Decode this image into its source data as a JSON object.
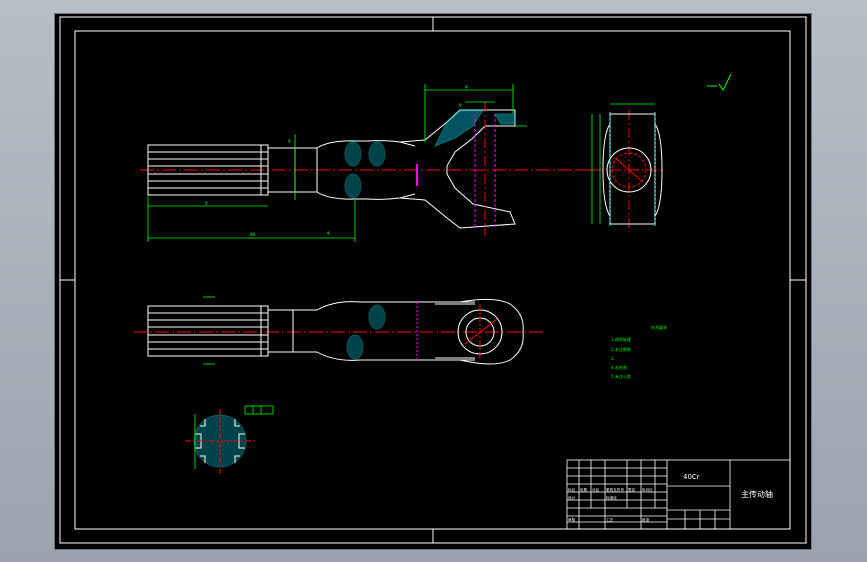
{
  "colors": {
    "background": "#000000",
    "frame": "#ffffff",
    "part": "#ffffff",
    "dimension": "#00ff00",
    "centerline": "#ff0000",
    "hatch": "#00ffff",
    "hidden": "#ff00ff"
  },
  "drawing": {
    "material_label": "40Cr",
    "part_name": "主传动轴"
  },
  "notes": {
    "heading": "技术要求",
    "lines": [
      "1.调质处理",
      "2.未注倒角",
      "3.",
      "4.去毛刺",
      "5.未注公差"
    ]
  },
  "title_block": {
    "row1": [
      "标记",
      "处数",
      "分区",
      "更改文件号",
      "签名",
      "年月日"
    ],
    "row2": [
      "设计",
      "",
      "标准化"
    ],
    "row3": [
      "审核",
      "",
      "",
      "工艺",
      "",
      "批准"
    ]
  }
}
